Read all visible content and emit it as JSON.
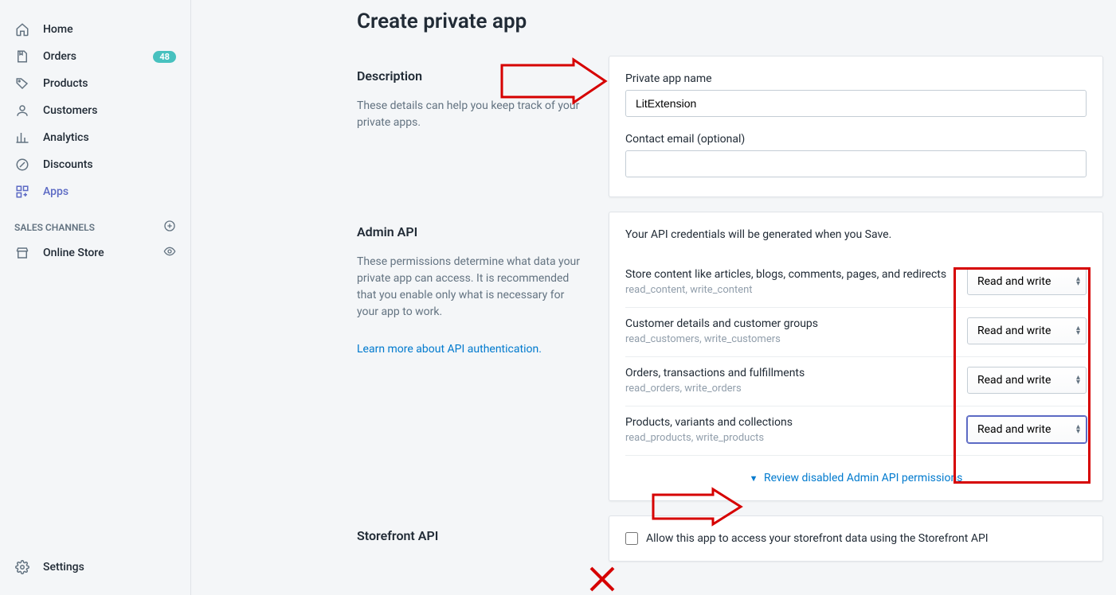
{
  "sidebar": {
    "items": [
      {
        "icon": "home-icon",
        "label": "Home"
      },
      {
        "icon": "orders-icon",
        "label": "Orders",
        "badge": "48"
      },
      {
        "icon": "products-icon",
        "label": "Products"
      },
      {
        "icon": "customers-icon",
        "label": "Customers"
      },
      {
        "icon": "analytics-icon",
        "label": "Analytics"
      },
      {
        "icon": "discounts-icon",
        "label": "Discounts"
      },
      {
        "icon": "apps-icon",
        "label": "Apps"
      }
    ],
    "channels_heading": "SALES CHANNELS",
    "channel_item": {
      "label": "Online Store"
    },
    "settings_label": "Settings"
  },
  "page": {
    "title": "Create private app"
  },
  "description": {
    "heading": "Description",
    "helper": "These details can help you keep track of your private apps.",
    "name_label": "Private app name",
    "name_value": "LitExtension",
    "email_label": "Contact email (optional)",
    "email_value": ""
  },
  "admin_api": {
    "heading": "Admin API",
    "helper": "These permissions determine what data your private app can access. It is recommended that you enable only what is necessary for your app to work.",
    "learn_more": "Learn more about API authentication",
    "credentials_note": "Your API credentials will be generated when you Save.",
    "select_value": "Read and write",
    "permissions": [
      {
        "title": "Store content like articles, blogs, comments, pages, and redirects",
        "meta": "read_content, write_content"
      },
      {
        "title": "Customer details and customer groups",
        "meta": "read_customers, write_customers"
      },
      {
        "title": "Orders, transactions and fulfillments",
        "meta": "read_orders, write_orders"
      },
      {
        "title": "Products, variants and collections",
        "meta": "read_products, write_products"
      }
    ],
    "review_link": "Review disabled Admin API permissions"
  },
  "storefront_api": {
    "heading": "Storefront API",
    "checkbox_label": "Allow this app to access your storefront data using the Storefront API"
  }
}
